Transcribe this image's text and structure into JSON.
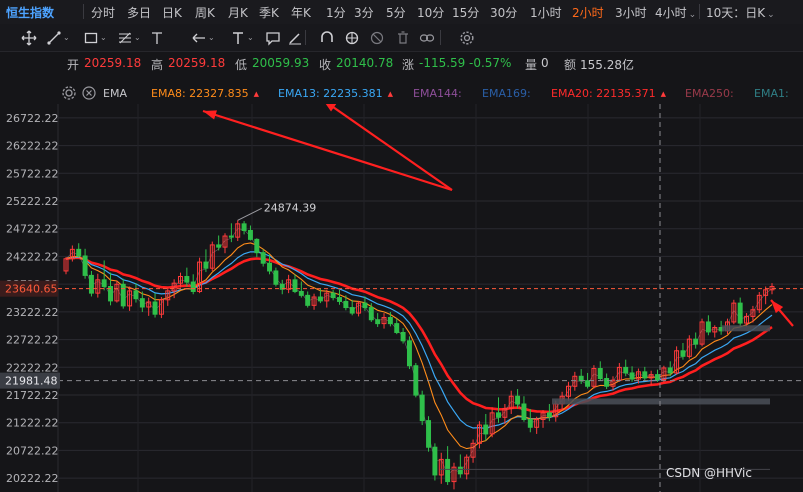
{
  "timeframes": {
    "items": [
      "恒生指数",
      "分时",
      "多日",
      "日K",
      "周K",
      "月K",
      "季K",
      "年K",
      "1分",
      "3分",
      "5分",
      "10分",
      "15分",
      "30分",
      "1小时",
      "2小时",
      "3小时",
      "4小时",
      "10天：日K"
    ],
    "active_index": 15,
    "title_index": 0,
    "dropdown_indices": [
      17,
      18
    ]
  },
  "toolbar": {
    "icons": [
      "crosshair-icon",
      "trendline-icon",
      "rectangle-icon",
      "fibonacci-icon",
      "horizontal-line-icon",
      "arrow-icon",
      "text-icon",
      "comment-icon",
      "pencil-icon",
      "magnet-icon",
      "sync-icon",
      "hide-icon",
      "trash-icon",
      "link-icon",
      "settings-icon"
    ]
  },
  "quote": {
    "open_label": "开",
    "open": "20259.18",
    "high_label": "高",
    "high": "20259.18",
    "low_label": "低",
    "low": "20059.93",
    "close_label": "收",
    "close": "20140.78",
    "change_label": "涨",
    "change": "-115.59",
    "change_pct": "-0.57%",
    "volume_label": "量",
    "volume": "0",
    "amount_label": "额",
    "amount": "155.28亿"
  },
  "indicators": {
    "name": "EMA",
    "items": [
      {
        "label": "EMA8:",
        "value": "22327.835",
        "color": "#ff8c1a"
      },
      {
        "label": "EMA13:",
        "value": "22235.381",
        "color": "#3aa8f5"
      },
      {
        "label": "EMA144:",
        "value": "",
        "color": "#8e4f9a"
      },
      {
        "label": "EMA169:",
        "value": "",
        "color": "#2a5fa8"
      },
      {
        "label": "EMA20:",
        "value": "22135.371",
        "color": "#ff2b2b"
      },
      {
        "label": "EMA250:",
        "value": "",
        "color": "#9a3a4a"
      },
      {
        "label": "EMA1:",
        "value": "",
        "color": "#2f7f86"
      }
    ]
  },
  "chart_data": {
    "type": "candlestick",
    "y_ticks": [
      26722.22,
      26222.22,
      25722.22,
      25222.22,
      24722.22,
      24222.22,
      23722.22,
      23222.22,
      22722.22,
      22222.22,
      21722.22,
      21222.22,
      20722.22,
      20222.22
    ],
    "ylim": [
      19972.22,
      26972.22
    ],
    "grid": true,
    "current_price_label": "23640.65",
    "crosshair_price_label": "21981.48",
    "peak_label": "24874.39",
    "candles": [
      [
        23960,
        24210,
        23900,
        24180
      ],
      [
        24180,
        24420,
        24130,
        24350
      ],
      [
        24350,
        24460,
        24210,
        24230
      ],
      [
        24230,
        24360,
        23820,
        23880
      ],
      [
        23880,
        23960,
        23500,
        23560
      ],
      [
        23560,
        23910,
        23480,
        23800
      ],
      [
        23800,
        24150,
        23610,
        23680
      ],
      [
        23680,
        23930,
        23340,
        23420
      ],
      [
        23420,
        23780,
        23390,
        23720
      ],
      [
        23720,
        23820,
        23280,
        23330
      ],
      [
        23330,
        23680,
        23240,
        23600
      ],
      [
        23600,
        23740,
        23390,
        23460
      ],
      [
        23460,
        23590,
        23220,
        23310
      ],
      [
        23310,
        23480,
        23150,
        23400
      ],
      [
        23400,
        23560,
        23120,
        23180
      ],
      [
        23180,
        23490,
        23110,
        23440
      ],
      [
        23440,
        23660,
        23330,
        23600
      ],
      [
        23600,
        23810,
        23470,
        23740
      ],
      [
        23740,
        23930,
        23660,
        23860
      ],
      [
        23860,
        24020,
        23680,
        23760
      ],
      [
        23760,
        23900,
        23540,
        23590
      ],
      [
        23590,
        24200,
        23560,
        24120
      ],
      [
        24120,
        24350,
        23940,
        24010
      ],
      [
        24010,
        24490,
        23960,
        24430
      ],
      [
        24430,
        24600,
        24330,
        24390
      ],
      [
        24390,
        24640,
        24280,
        24590
      ],
      [
        24590,
        24820,
        24480,
        24570
      ],
      [
        24570,
        24874.39,
        24500,
        24810
      ],
      [
        24810,
        24860,
        24620,
        24690
      ],
      [
        24690,
        24780,
        24510,
        24530
      ],
      [
        24530,
        24550,
        24210,
        24290
      ],
      [
        24290,
        24350,
        24040,
        24100
      ],
      [
        24100,
        24260,
        23900,
        23960
      ],
      [
        23960,
        24020,
        23680,
        23720
      ],
      [
        23720,
        23800,
        23540,
        23630
      ],
      [
        23630,
        23890,
        23560,
        23800
      ],
      [
        23800,
        23900,
        23560,
        23590
      ],
      [
        23590,
        23770,
        23480,
        23520
      ],
      [
        23520,
        23590,
        23300,
        23340
      ],
      [
        23340,
        23550,
        23260,
        23490
      ],
      [
        23490,
        23650,
        23380,
        23420
      ],
      [
        23420,
        23620,
        23300,
        23560
      ],
      [
        23560,
        23620,
        23430,
        23480
      ],
      [
        23480,
        23620,
        23350,
        23410
      ],
      [
        23410,
        23520,
        23250,
        23300
      ],
      [
        23300,
        23440,
        23160,
        23200
      ],
      [
        23200,
        23420,
        23140,
        23380
      ],
      [
        23380,
        23500,
        23240,
        23300
      ],
      [
        23300,
        23380,
        23040,
        23080
      ],
      [
        23080,
        23200,
        22950,
        23010
      ],
      [
        23010,
        23200,
        22920,
        23120
      ],
      [
        23120,
        23220,
        22960,
        23010
      ],
      [
        23010,
        23100,
        22820,
        22850
      ],
      [
        22850,
        22930,
        22650,
        22700
      ],
      [
        22700,
        22780,
        22190,
        22250
      ],
      [
        22250,
        22300,
        21680,
        21720
      ],
      [
        21720,
        21800,
        21180,
        21260
      ],
      [
        21260,
        21340,
        20700,
        20780
      ],
      [
        20780,
        20850,
        20180,
        20280
      ],
      [
        20280,
        20680,
        20120,
        20560
      ],
      [
        20560,
        20800,
        20100,
        20160
      ],
      [
        20160,
        20500,
        20020,
        20420
      ],
      [
        20420,
        20650,
        20230,
        20300
      ],
      [
        20300,
        20650,
        20200,
        20600
      ],
      [
        20600,
        20920,
        20500,
        20850
      ],
      [
        20850,
        21250,
        20760,
        21180
      ],
      [
        21180,
        21380,
        20900,
        21020
      ],
      [
        21020,
        21500,
        20960,
        21400
      ],
      [
        21400,
        21680,
        21220,
        21320
      ],
      [
        21320,
        21560,
        21200,
        21480
      ],
      [
        21480,
        21800,
        21380,
        21700
      ],
      [
        21700,
        21830,
        21480,
        21560
      ],
      [
        21560,
        21700,
        21240,
        21280
      ],
      [
        21280,
        21470,
        21050,
        21140
      ],
      [
        21140,
        21330,
        21020,
        21280
      ],
      [
        21280,
        21450,
        21130,
        21400
      ],
      [
        21400,
        21560,
        21250,
        21330
      ],
      [
        21330,
        21620,
        21240,
        21560
      ],
      [
        21560,
        21780,
        21450,
        21700
      ],
      [
        21700,
        21960,
        21620,
        21880
      ],
      [
        21880,
        22140,
        21800,
        22060
      ],
      [
        22060,
        22190,
        21920,
        21980
      ],
      [
        21980,
        22120,
        21840,
        21880
      ],
      [
        21880,
        22260,
        21840,
        22200
      ],
      [
        22200,
        22330,
        21980,
        22020
      ],
      [
        22020,
        22110,
        21830,
        21880
      ],
      [
        21880,
        22060,
        21800,
        21990
      ],
      [
        21990,
        22300,
        21960,
        22220
      ],
      [
        22220,
        22360,
        22060,
        22120
      ],
      [
        22120,
        22240,
        21960,
        22010
      ],
      [
        22010,
        22200,
        21930,
        22140
      ],
      [
        22140,
        22230,
        21980,
        22030
      ],
      [
        22030,
        22160,
        21900,
        22090
      ],
      [
        22090,
        22180,
        21960,
        22000
      ],
      [
        22000,
        22250,
        21950,
        22210
      ],
      [
        22210,
        22330,
        22060,
        22120
      ],
      [
        22120,
        22600,
        22090,
        22520
      ],
      [
        22520,
        22660,
        22360,
        22420
      ],
      [
        22420,
        22800,
        22380,
        22730
      ],
      [
        22730,
        22850,
        22560,
        22640
      ],
      [
        22640,
        23100,
        22600,
        23040
      ],
      [
        23040,
        23160,
        22800,
        22860
      ],
      [
        22860,
        22980,
        22760,
        22940
      ],
      [
        22940,
        23060,
        22810,
        22880
      ],
      [
        22880,
        23100,
        22820,
        23040
      ],
      [
        23040,
        23440,
        23000,
        23380
      ],
      [
        23380,
        23480,
        22960,
        23020
      ],
      [
        23020,
        23200,
        22960,
        23140
      ],
      [
        23140,
        23330,
        23030,
        23260
      ],
      [
        23260,
        23580,
        23200,
        23520
      ],
      [
        23520,
        23680,
        23360,
        23620
      ],
      [
        23620,
        23740,
        23540,
        23680
      ]
    ]
  },
  "watermark": "CSDN @HHVic"
}
